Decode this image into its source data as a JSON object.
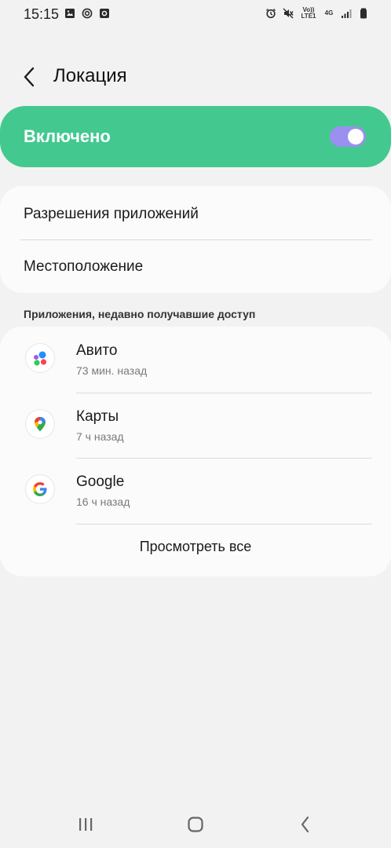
{
  "status_bar": {
    "time": "15:15",
    "left_icons": [
      "image-icon",
      "at-sign-icon",
      "camera-app-icon"
    ],
    "right_icons": [
      "alarm-icon",
      "mute-icon",
      "volte-icon",
      "lte-4g-icon",
      "signal-icon",
      "battery-icon"
    ],
    "volte_label": "Vo)) LTE1",
    "network_label": "4G"
  },
  "header": {
    "back_icon": "chevron-left-icon",
    "title": "Локация"
  },
  "master_toggle": {
    "label": "Включено",
    "state": "on",
    "card_color": "#43c98f",
    "switch_color": "#9b8ff0"
  },
  "settings": {
    "items": [
      {
        "label": "Разрешения приложений"
      },
      {
        "label": "Местоположение"
      }
    ]
  },
  "recent_access": {
    "section_title": "Приложения, недавно получавшие доступ",
    "apps": [
      {
        "name": "Авито",
        "time": "73 мин. назад",
        "icon": "avito-icon"
      },
      {
        "name": "Карты",
        "time": "7 ч назад",
        "icon": "maps-icon"
      },
      {
        "name": "Google",
        "time": "16 ч назад",
        "icon": "google-icon"
      }
    ],
    "view_all": "Просмотреть все"
  },
  "nav_bar": {
    "buttons": [
      "recents-icon",
      "home-icon",
      "back-icon"
    ]
  }
}
